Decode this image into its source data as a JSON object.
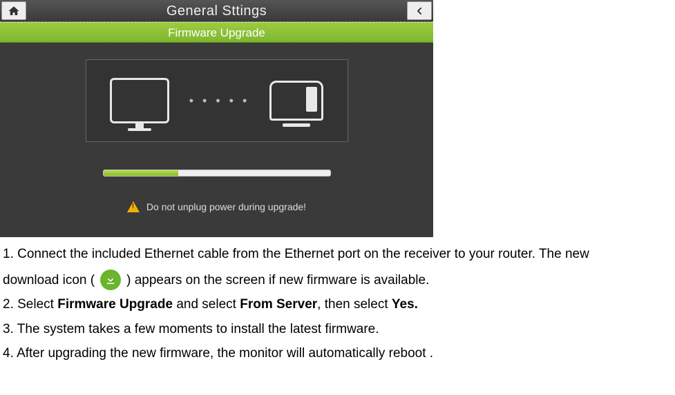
{
  "screenshot": {
    "title": "General Sttings",
    "subtitle": "Firmware Upgrade",
    "progress_pct": 33,
    "warning_text": "Do not unplug power during upgrade!"
  },
  "instructions": {
    "step1a": "1. Connect the included Ethernet cable from the Ethernet port on the receiver to your router. The new",
    "step1b_prefix": "download icon (",
    "step1b_suffix": ") appears on the screen if new firmware is available.",
    "step2_prefix": "2. Select ",
    "step2_b1": "Firmware Upgrade",
    "step2_mid1": " and select ",
    "step2_b2": "From Server",
    "step2_mid2": ", then select ",
    "step2_b3": "Yes.",
    "step3": "3. The system takes a few moments to install the latest firmware.",
    "step4": "4. After upgrading the new firmware, the monitor will automatically reboot ."
  }
}
